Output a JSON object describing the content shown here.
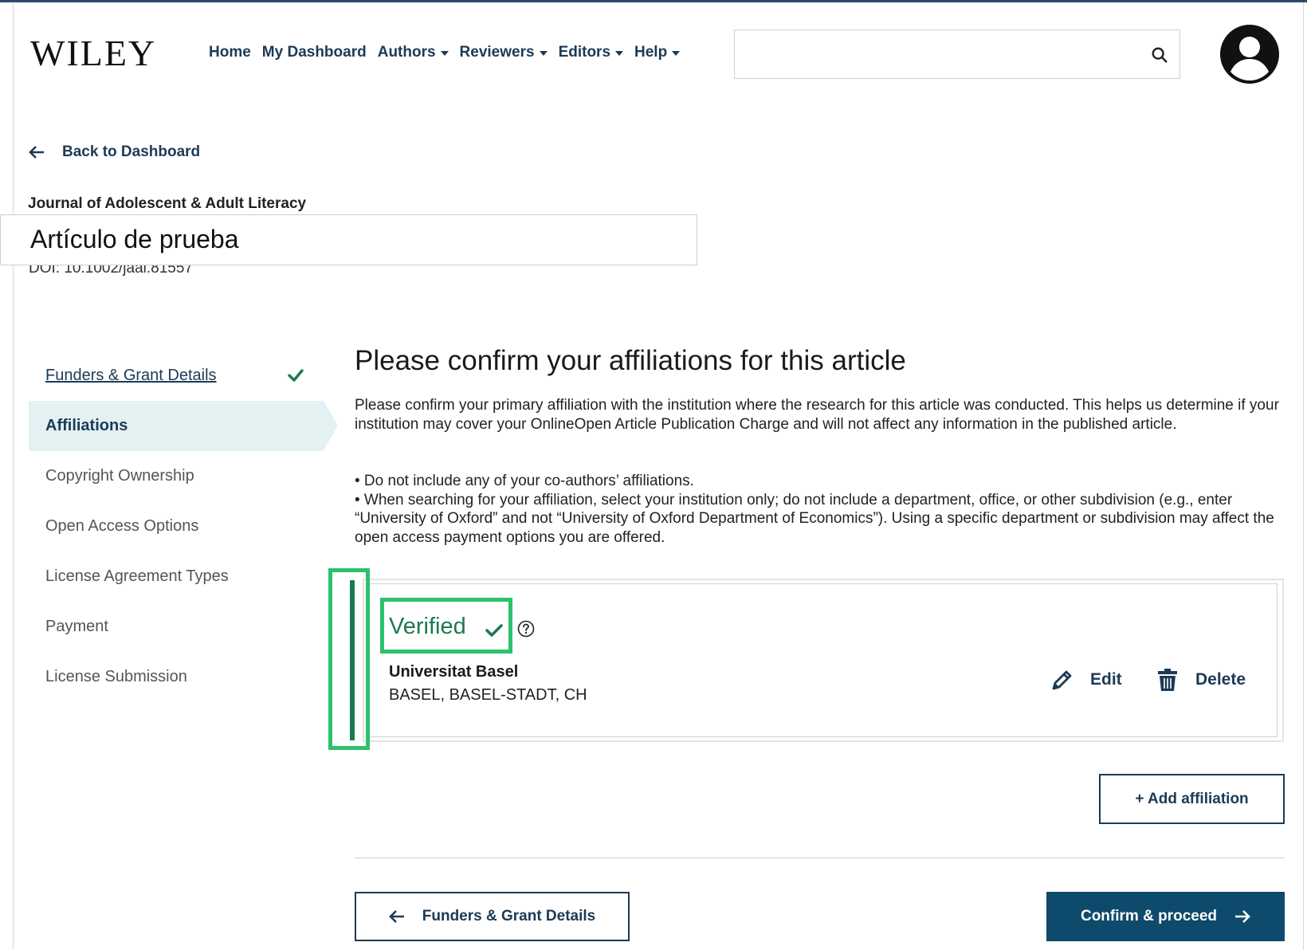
{
  "header": {
    "logo": "WILEY",
    "nav": [
      {
        "label": "Home",
        "dropdown": false
      },
      {
        "label": "My Dashboard",
        "dropdown": false
      },
      {
        "label": "Authors",
        "dropdown": true
      },
      {
        "label": "Reviewers",
        "dropdown": true
      },
      {
        "label": "Editors",
        "dropdown": true
      },
      {
        "label": "Help",
        "dropdown": true
      }
    ],
    "search": {
      "value": "",
      "placeholder": "",
      "icon": "search-icon"
    },
    "avatar_icon": "user-circle-icon"
  },
  "back_link": {
    "label": "Back to Dashboard",
    "icon": "arrow-left-icon"
  },
  "article": {
    "journal": "Journal of Adolescent & Adult Literacy",
    "title": "Artículo de prueba",
    "doi": "DOI: 10.1002/jaal.81557"
  },
  "steps": [
    {
      "label": "Funders & Grant Details",
      "state": "completed"
    },
    {
      "label": "Affiliations",
      "state": "active"
    },
    {
      "label": "Copyright Ownership",
      "state": "pending"
    },
    {
      "label": "Open Access Options",
      "state": "pending"
    },
    {
      "label": "License Agreement Types",
      "state": "pending"
    },
    {
      "label": "Payment",
      "state": "pending"
    },
    {
      "label": "License Submission",
      "state": "pending"
    }
  ],
  "main": {
    "heading": "Please confirm your affiliations for this article",
    "intro": "Please confirm your primary affiliation with the institution where the research for this article was conducted. This helps us determine if your institution may cover your OnlineOpen Article Publication Charge and will not affect any information in the published article.",
    "bullets": [
      "• Do not include any of your co-authors’ affiliations.",
      "• When searching for your affiliation, select your institution only; do not include a department, office, or other subdivision (e.g., enter “University of Oxford” and not “University of Oxford Department of Economics”). Using a specific department or subdivision may affect the open access payment options you are offered."
    ],
    "affiliation": {
      "status": "Verified",
      "name": "Universitat Basel",
      "location": "BASEL, BASEL-STADT, CH",
      "edit_label": "Edit",
      "delete_label": "Delete"
    },
    "add_affiliation_label": "+ Add affiliation",
    "prev_label": "Funders & Grant Details",
    "next_label": "Confirm & proceed"
  },
  "colors": {
    "navy": "#1c3a55",
    "verified_green": "#1b7a4f",
    "highlight_green": "#2bc26a",
    "primary_button": "#0e4a6b",
    "active_step_bg": "#e4f1f3"
  }
}
